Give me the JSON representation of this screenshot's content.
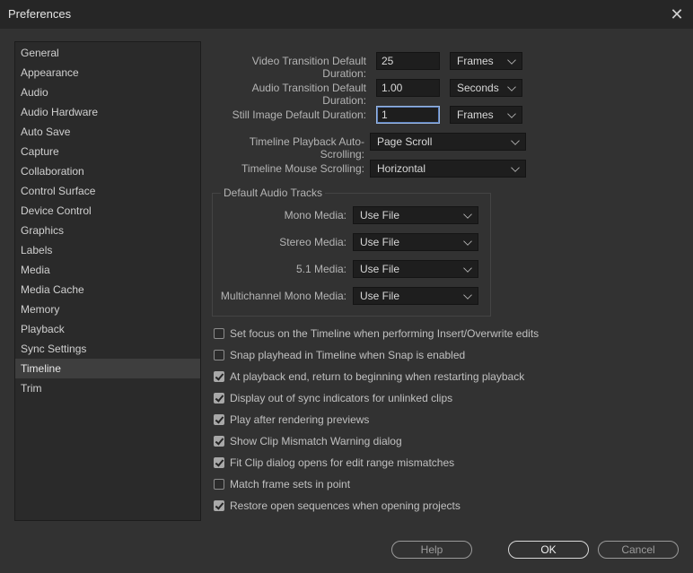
{
  "window": {
    "title": "Preferences",
    "close_icon": "close-icon"
  },
  "sidebar": {
    "items": [
      {
        "label": "General"
      },
      {
        "label": "Appearance"
      },
      {
        "label": "Audio"
      },
      {
        "label": "Audio Hardware"
      },
      {
        "label": "Auto Save"
      },
      {
        "label": "Capture"
      },
      {
        "label": "Collaboration"
      },
      {
        "label": "Control Surface"
      },
      {
        "label": "Device Control"
      },
      {
        "label": "Graphics"
      },
      {
        "label": "Labels"
      },
      {
        "label": "Media"
      },
      {
        "label": "Media Cache"
      },
      {
        "label": "Memory"
      },
      {
        "label": "Playback"
      },
      {
        "label": "Sync Settings"
      },
      {
        "label": "Timeline"
      },
      {
        "label": "Trim"
      }
    ],
    "selected": "Timeline"
  },
  "durations": {
    "video": {
      "label": "Video Transition Default Duration:",
      "value": "25",
      "unit": "Frames"
    },
    "audio": {
      "label": "Audio Transition Default Duration:",
      "value": "1.00",
      "unit": "Seconds"
    },
    "still": {
      "label": "Still Image Default Duration:",
      "value": "1",
      "unit": "Frames"
    }
  },
  "timeline": {
    "playback_autoscroll": {
      "label": "Timeline Playback Auto-Scrolling:",
      "value": "Page Scroll"
    },
    "mouse_scrolling": {
      "label": "Timeline Mouse Scrolling:",
      "value": "Horizontal"
    }
  },
  "audio_tracks": {
    "title": "Default Audio Tracks",
    "mono": {
      "label": "Mono Media:",
      "value": "Use File"
    },
    "stereo": {
      "label": "Stereo Media:",
      "value": "Use File"
    },
    "five_one": {
      "label": "5.1 Media:",
      "value": "Use File"
    },
    "multichannel": {
      "label": "Multichannel Mono Media:",
      "value": "Use File"
    }
  },
  "options": [
    {
      "label": "Set focus on the Timeline when performing Insert/Overwrite edits",
      "checked": false
    },
    {
      "label": "Snap playhead in Timeline when Snap is enabled",
      "checked": false
    },
    {
      "label": "At playback end, return to beginning when restarting playback",
      "checked": true
    },
    {
      "label": "Display out of sync indicators for unlinked clips",
      "checked": true
    },
    {
      "label": "Play after rendering previews",
      "checked": true
    },
    {
      "label": "Show Clip Mismatch Warning dialog",
      "checked": true
    },
    {
      "label": "Fit Clip dialog opens for edit range mismatches",
      "checked": true
    },
    {
      "label": "Match frame sets in point",
      "checked": false
    },
    {
      "label": "Restore open sequences when opening projects",
      "checked": true
    }
  ],
  "buttons": {
    "help": "Help",
    "ok": "OK",
    "cancel": "Cancel"
  }
}
